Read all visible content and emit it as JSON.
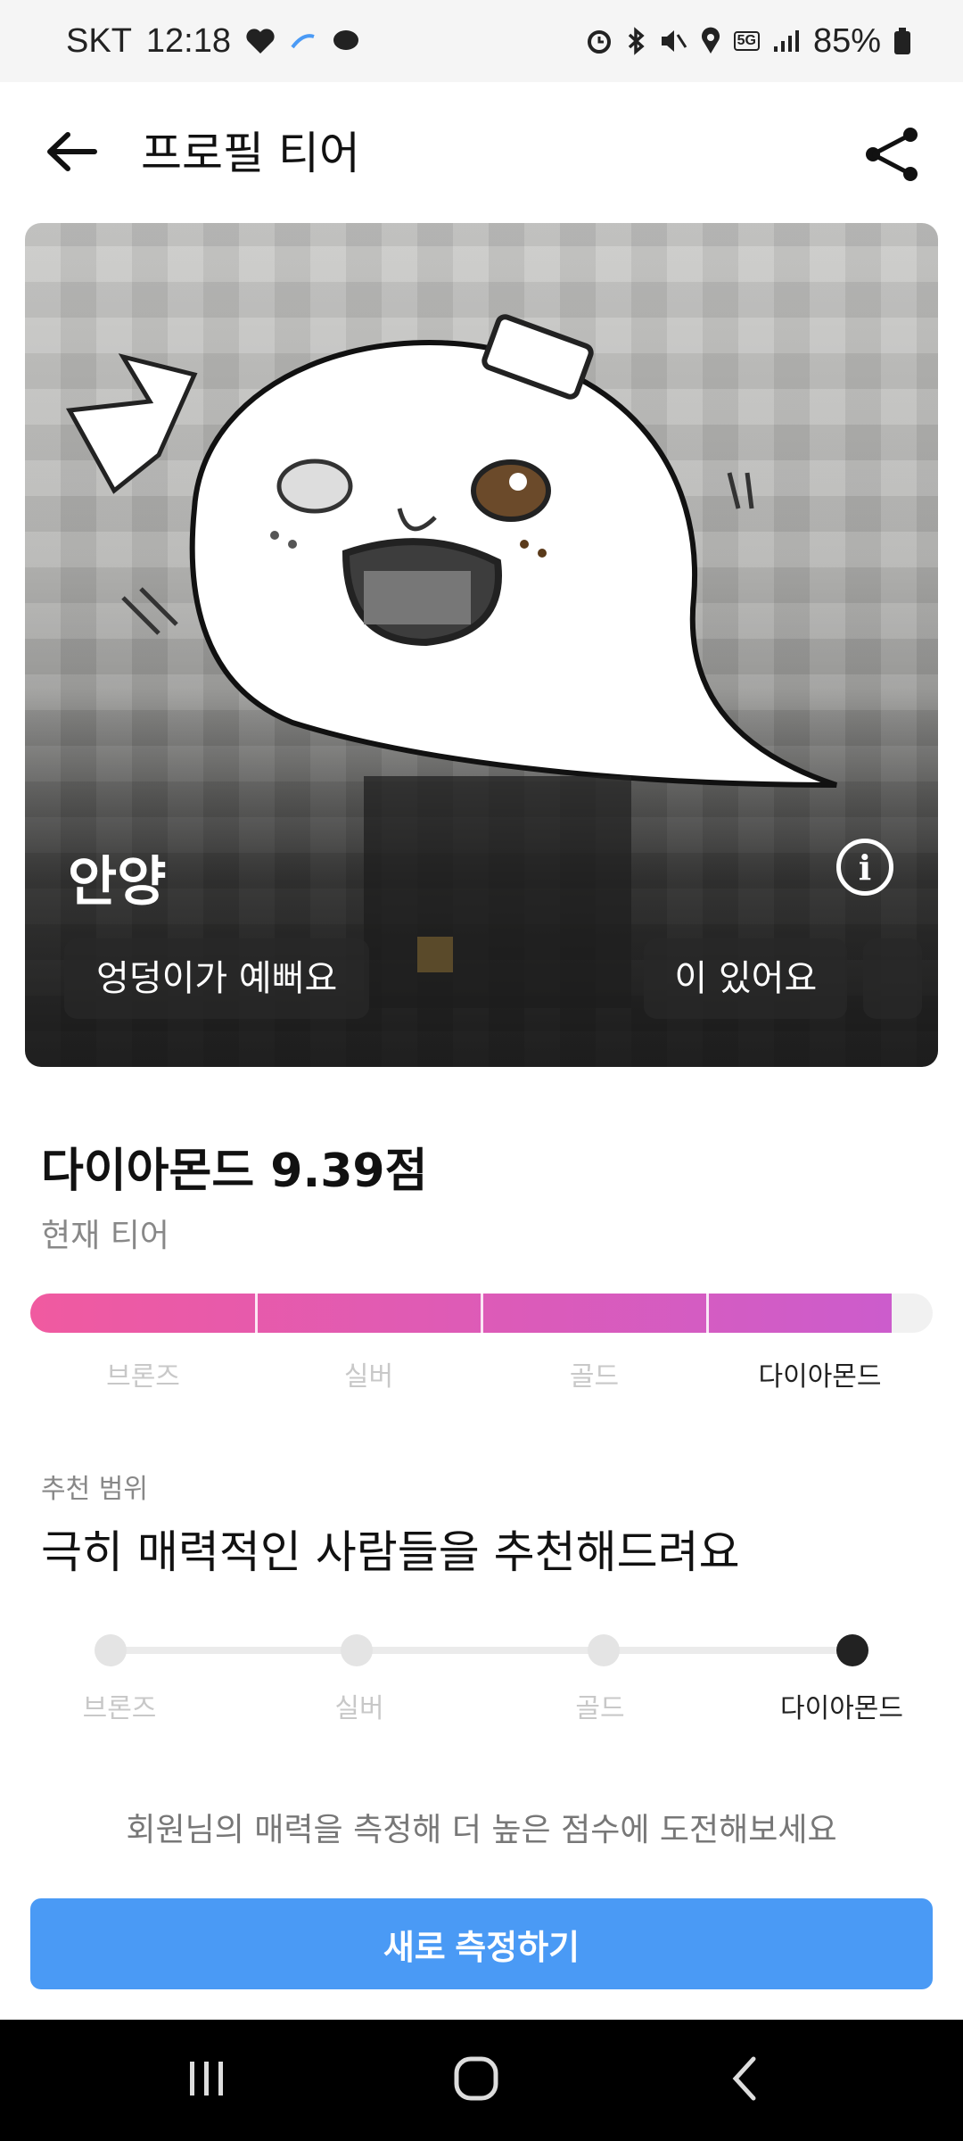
{
  "status_bar": {
    "carrier": "SKT",
    "time": "12:18",
    "network": "5G",
    "battery": "85%"
  },
  "app_bar": {
    "title": "프로필 티어"
  },
  "profile": {
    "name": "안양",
    "tags": [
      "엉덩이가 예뻐요",
      "이 있어요"
    ]
  },
  "tier": {
    "score_text": "다이아몬드 9.39점",
    "current_label": "현재 티어",
    "levels": [
      "브론즈",
      "실버",
      "골드",
      "다이아몬드"
    ],
    "active_level": "다이아몬드",
    "fill_fraction": 0.955,
    "bar_colors": [
      "#f05aa0",
      "#cc5ccc"
    ]
  },
  "recommend": {
    "label": "추천 범위",
    "text": "극히 매력적인 사람들을 추천해드려요",
    "levels": [
      "브론즈",
      "실버",
      "골드",
      "다이아몬드"
    ],
    "active_level": "다이아몬드"
  },
  "challenge_text": "회원님의 매력을 측정해 더 높은 점수에 도전해보세요",
  "cta_label": "새로 측정하기",
  "colors": {
    "accent_blue": "#4a9af5",
    "pink_start": "#f05aa0",
    "purple_end": "#cc5ccc"
  },
  "icons": {
    "back": "arrow-left-icon",
    "share": "share-icon",
    "info": "info-icon",
    "nav_recent": "recent-apps-icon",
    "nav_home": "home-icon",
    "nav_back": "nav-back-icon"
  }
}
